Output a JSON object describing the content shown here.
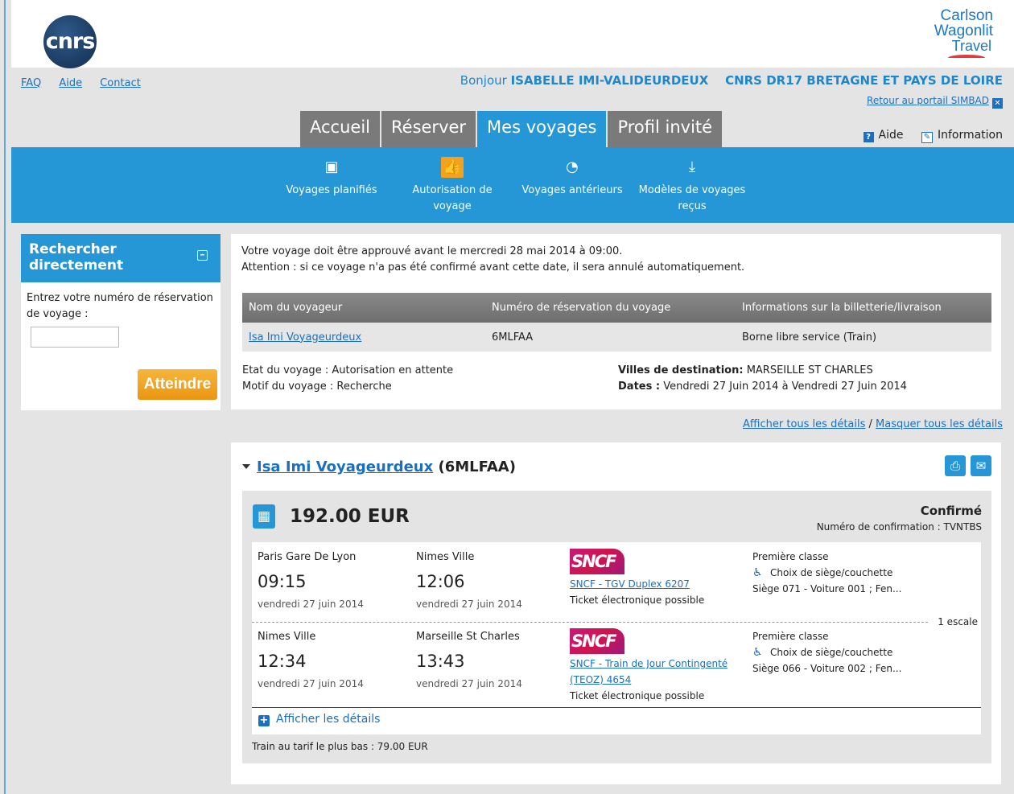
{
  "logos": {
    "cnrs": "cnrs",
    "cwt_line1": "Carlson",
    "cwt_line2": "Wagonlit",
    "cwt_line3": "Travel"
  },
  "top_links": {
    "faq": "FAQ",
    "help": "Aide",
    "contact": "Contact"
  },
  "greeting": {
    "prefix": "Bonjour",
    "user": "ISABELLE IMI-VALIDEURDEUX",
    "org": "CNRS DR17 BRETAGNE ET PAYS DE LOIRE"
  },
  "back_portal": "Retour au portail SIMBAD",
  "tabs": [
    {
      "label": "Accueil"
    },
    {
      "label": "Réserver"
    },
    {
      "label": "Mes voyages"
    },
    {
      "label": "Profil invité"
    }
  ],
  "help_links": {
    "help": "Aide",
    "info": "Information"
  },
  "subnav": [
    {
      "label": "Voyages planifiés",
      "icon": "calendar-icon"
    },
    {
      "label": "Autorisation de voyage",
      "icon": "thumbs-up-icon"
    },
    {
      "label": "Voyages antérieurs",
      "icon": "history-icon"
    },
    {
      "label": "Modèles de voyages reçus",
      "icon": "download-icon"
    }
  ],
  "search": {
    "title": "Rechercher directement",
    "label": "Entrez votre numéro de réservation de voyage :",
    "value": "",
    "button": "Atteindre"
  },
  "info": {
    "line1": "Votre voyage doit être approuvé avant le mercredi 28 mai 2014 à 09:00.",
    "line2": "Attention : si ce voyage n'a pas été confirmé avant cette date, il sera annulé automatiquement.",
    "table_headers": [
      "Nom du voyageur",
      "Numéro de réservation du voyage",
      "Informations sur la billetterie/livraison"
    ],
    "row": {
      "name": "Isa Imi Voyageurdeux",
      "ref": "6MLFAA",
      "delivery": "Borne libre service (Train)"
    },
    "state_label": "Etat du voyage :",
    "state_value": "Autorisation en attente",
    "reason_label": "Motif du voyage :",
    "reason_value": "Recherche",
    "dest_label": "Villes de destination:",
    "dest_value": "MARSEILLE ST CHARLES",
    "dates_label": "Dates :",
    "dates_value": "Vendredi 27 Juin 2014 à Vendredi 27 Juin 2014"
  },
  "details_links": {
    "show_all": "Afficher tous les détails",
    "sep": "/",
    "hide_all": "Masquer tous les détails"
  },
  "trip": {
    "traveler": "Isa Imi Voyageurdeux",
    "ref": "(6MLFAA)",
    "price": "192.00 EUR",
    "status": "Confirmé",
    "confirmation": "Numéro de confirmation : TVNTBS",
    "segments": [
      {
        "dep_station": "Paris Gare De Lyon",
        "dep_time": "09:15",
        "dep_date": "vendredi 27 juin 2014",
        "arr_station": "Nimes Ville",
        "arr_time": "12:06",
        "arr_date": "vendredi 27 juin 2014",
        "carrier_logo": "SNCF",
        "train": "SNCF - TGV Duplex 6207",
        "ticket": "Ticket électronique possible",
        "class": "Première classe",
        "seat_choice": "Choix de siège/couchette",
        "seat": "Siège 071 - Voiture 001 ; Fen..."
      },
      {
        "dep_station": "Nimes Ville",
        "dep_time": "12:34",
        "dep_date": "vendredi 27 juin 2014",
        "arr_station": "Marseille St Charles",
        "arr_time": "13:43",
        "arr_date": "vendredi 27 juin 2014",
        "carrier_logo": "SNCF",
        "train": "SNCF - Train de Jour Contingenté (TEOZ) 4654",
        "ticket": "Ticket électronique possible",
        "class": "Première classe",
        "seat_choice": "Choix de siège/couchette",
        "seat": "Siège 066 - Voiture 002 ; Fen..."
      }
    ],
    "stops": "1 escale",
    "show_details": "Afficher les détails",
    "low_fare": "Train au tarif le plus bas : 79.00 EUR"
  }
}
